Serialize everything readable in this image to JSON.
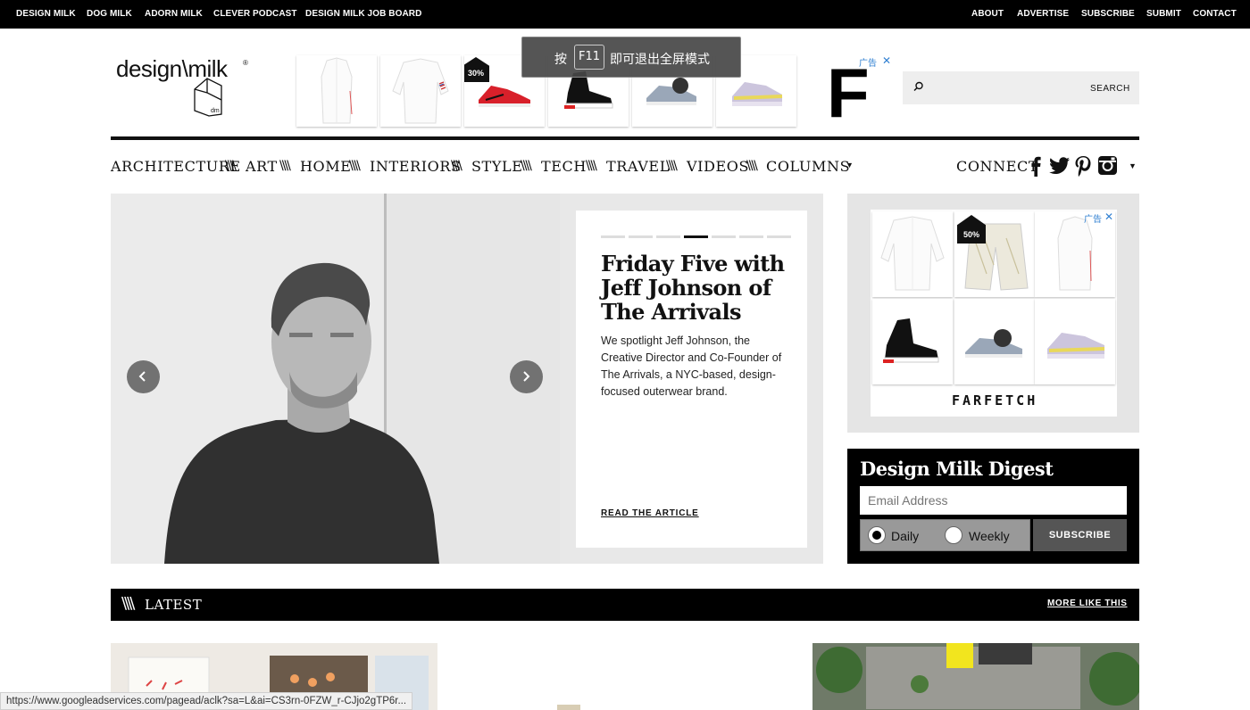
{
  "topbar": {
    "left": [
      "DESIGN MILK",
      "DOG MILK",
      "ADORN MILK",
      "CLEVER PODCAST",
      "DESIGN MILK JOB BOARD"
    ],
    "right": [
      "ABOUT",
      "ADVERTISE",
      "SUBSCRIBE",
      "SUBMIT",
      "CONTACT"
    ]
  },
  "logo": {
    "text": "design\\milk",
    "mark": "dm"
  },
  "ad": {
    "badge": "30%",
    "label": "广告"
  },
  "search": {
    "placeholder": "",
    "button": "SEARCH"
  },
  "nav": {
    "items": [
      "ARCHITECTURE",
      "ART",
      "HOME",
      "INTERIORS",
      "STYLE",
      "TECH",
      "TRAVEL",
      "VIDEOS",
      "COLUMNS"
    ],
    "connect": "CONNECT"
  },
  "hero": {
    "title": "Friday Five with Jeff Johnson of The Arrivals",
    "text": "We spotlight Jeff Johnson, the Creative Director and Co-Founder of The Arrivals, a NYC-based, design-focused outerwear brand.",
    "link": "READ THE ARTICLE",
    "slide_count": 7,
    "active_slide": 4
  },
  "side_ad": {
    "badge": "50%",
    "label": "广告",
    "brand": "FARFETCH"
  },
  "digest": {
    "title": "Design Milk Digest",
    "email_placeholder": "Email Address",
    "daily": "Daily",
    "weekly": "Weekly",
    "button": "SUBSCRIBE"
  },
  "latest": {
    "label": "LATEST",
    "more": "MORE LIKE THIS"
  },
  "overlay": {
    "prefix": "按",
    "key": "F11",
    "suffix": "即可退出全屏模式"
  },
  "status_url": "https://www.googleadservices.com/pagead/aclk?sa=L&ai=CS3rn-0FZW_r-CJjo2gTP6r...",
  "colors": {
    "accent": "#000000",
    "ad_blue": "#2f7fd1",
    "panel_gray": "#e5e5e5"
  }
}
